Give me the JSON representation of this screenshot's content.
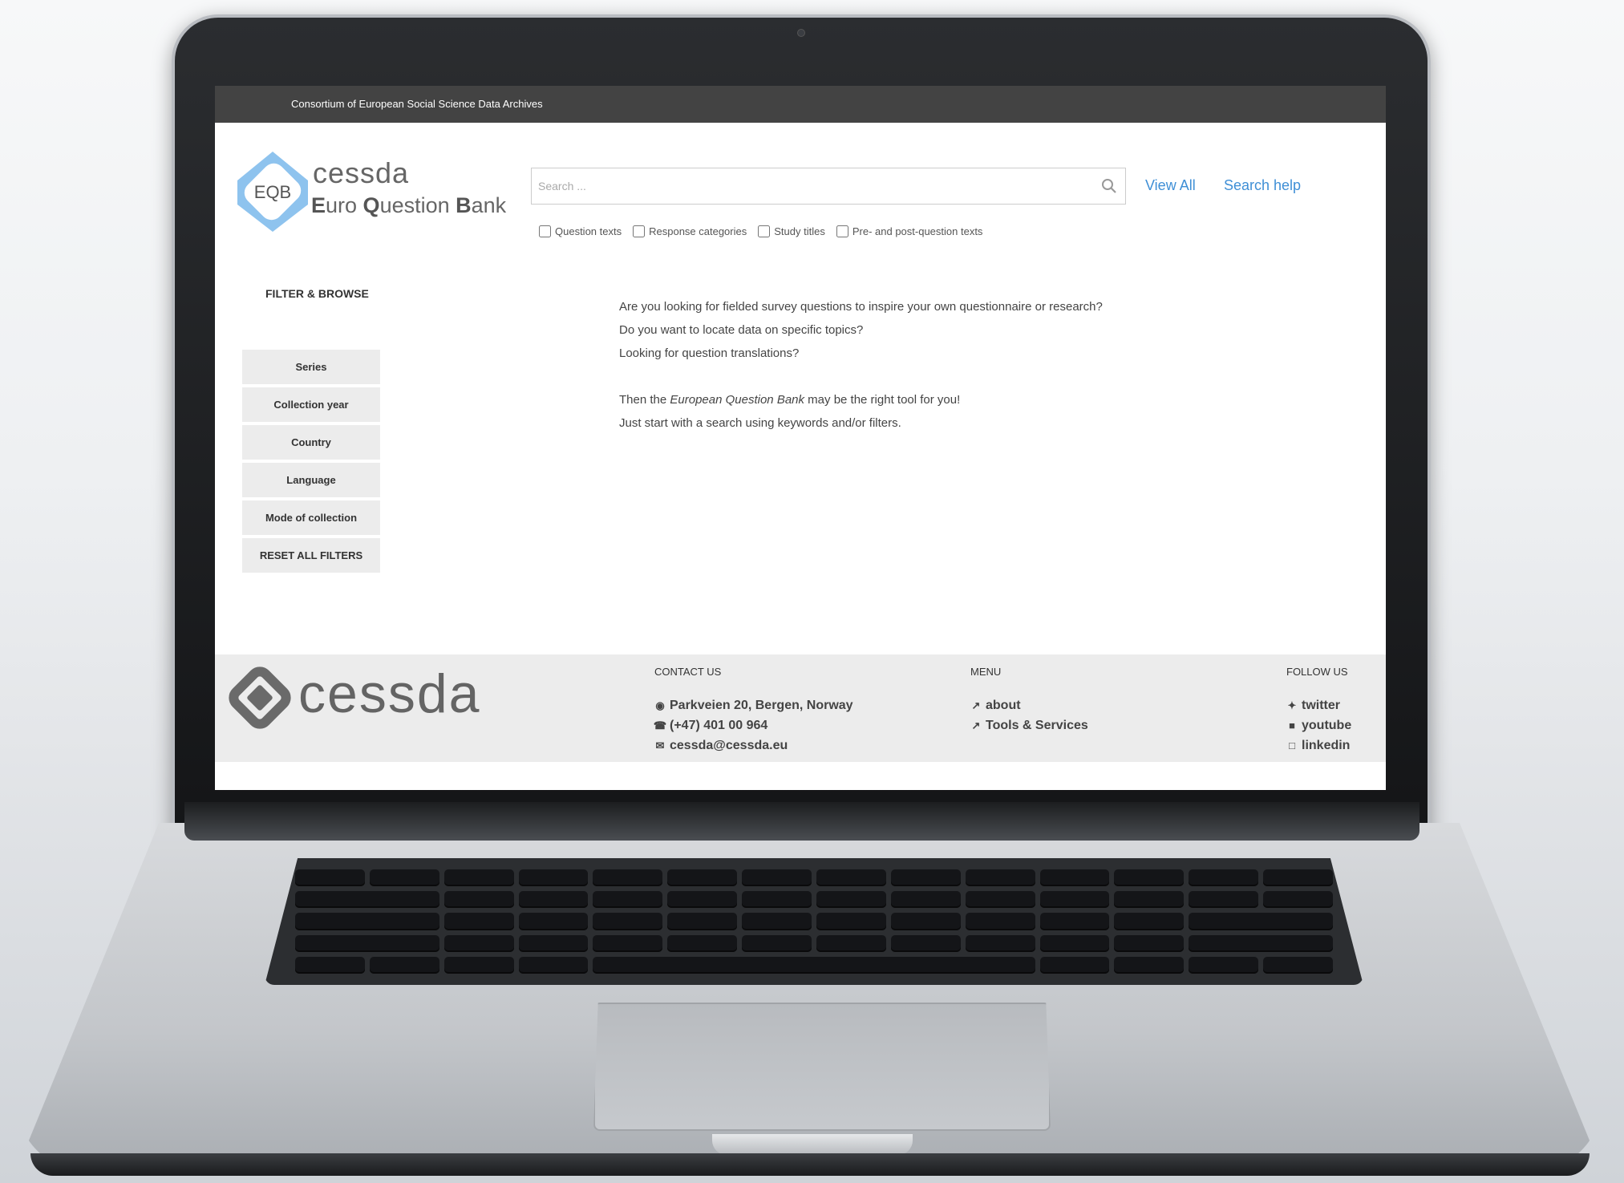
{
  "topbar": {
    "text": "Consortium of European Social Science Data Archives"
  },
  "brand": {
    "logo_text": "EQB",
    "cessda": "cessda",
    "product_e": "E",
    "product_uro": "uro ",
    "product_q": "Q",
    "product_uestion": "uestion ",
    "product_b": "B",
    "product_ank": "ank"
  },
  "search": {
    "placeholder": "Search ...",
    "view_all": "View All",
    "help": "Search help",
    "options": [
      "Question texts",
      "Response categories",
      "Study titles",
      "Pre- and post-question texts"
    ]
  },
  "filters": {
    "title": "FILTER & BROWSE",
    "items": [
      "Series",
      "Collection year",
      "Country",
      "Language",
      "Mode of collection",
      "RESET ALL FILTERS"
    ]
  },
  "intro": {
    "line1": "Are you looking for fielded survey questions to inspire your own questionnaire or research?",
    "line2": "Do you want to locate data on specific topics?",
    "line3": "Looking for question translations?",
    "line4_pre": "Then the ",
    "line4_em": "European Question Bank",
    "line4_post": " may be the right tool for you!",
    "line5": "Just start with a search using keywords and/or filters."
  },
  "footer": {
    "logo_text": "cessda",
    "contact": {
      "title": "CONTACT US",
      "address": "Parkveien 20, Bergen, Norway",
      "phone": "(+47) 401 00 964",
      "email": "cessda@cessda.eu"
    },
    "menu": {
      "title": "MENU",
      "items": [
        "about",
        "Tools & Services"
      ]
    },
    "follow": {
      "title": "FOLLOW US",
      "items": [
        "twitter",
        "youtube",
        "linkedin"
      ]
    }
  },
  "colors": {
    "link": "#3f8fd6",
    "topbar": "#434343",
    "footer_bg": "#ececec",
    "logo_blue": "#8ec3ee"
  }
}
